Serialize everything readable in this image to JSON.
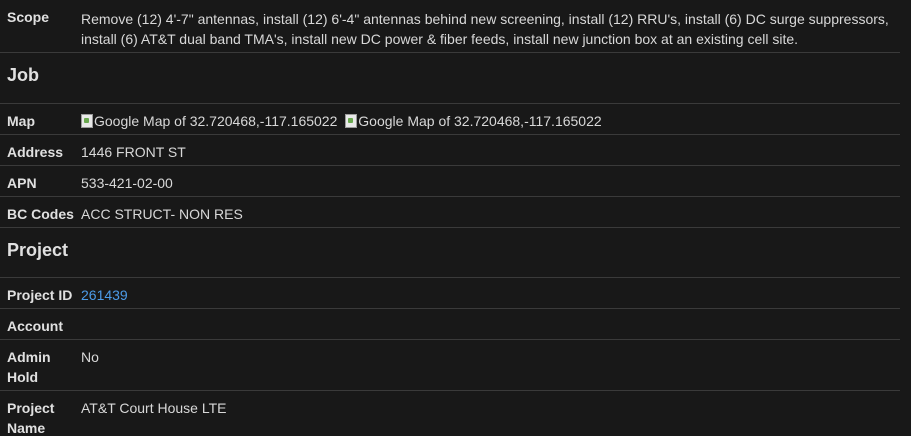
{
  "scope": {
    "label": "Scope",
    "value": "Remove (12) 4'-7\" antennas, install (12) 6'-4\" antennas behind new screening, install (12) RRU's, install (6) DC surge suppressors, install (6) AT&T dual band TMA's, install new DC power & fiber feeds, install new junction box at an existing cell site."
  },
  "job": {
    "heading": "Job",
    "map_label": "Map",
    "map_alt_1": "Google Map of 32.720468,-117.165022",
    "map_alt_2": "Google Map of 32.720468,-117.165022",
    "address_label": "Address",
    "address_value": "1446 FRONT ST",
    "apn_label": "APN",
    "apn_value": "533-421-02-00",
    "bc_label": "BC Codes",
    "bc_value": "ACC STRUCT- NON RES"
  },
  "project": {
    "heading": "Project",
    "id_label": "Project ID",
    "id_value": "261439",
    "account_label": "Account",
    "account_value": "",
    "hold_label": "Admin Hold",
    "hold_value": "No",
    "name_label": "Project Name",
    "name_value": "AT&T Court House LTE"
  },
  "colors": {
    "background": "#181818",
    "link": "#4c9be8",
    "divider": "#3a3a3a"
  }
}
